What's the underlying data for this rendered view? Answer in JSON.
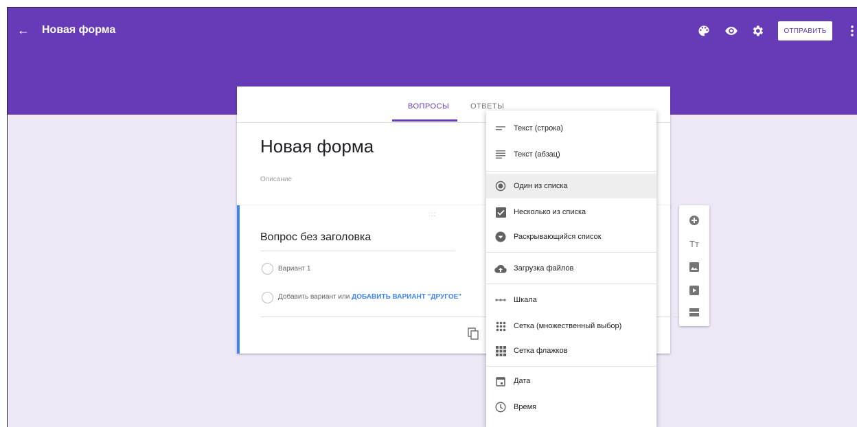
{
  "header": {
    "back_icon": "arrow-left-icon",
    "title": "Новая форма",
    "icons": [
      "palette-icon",
      "eye-icon",
      "gear-icon"
    ],
    "send_label": "ОТПРАВИТЬ",
    "more_icon": "more-vert-icon",
    "color": "#673ab7"
  },
  "tabs": {
    "questions": "ВОПРОСЫ",
    "answers": "ОТВЕТЫ",
    "active": "ВОПРОСЫ"
  },
  "form": {
    "title": "Новая форма",
    "description_placeholder": "Описание"
  },
  "question": {
    "title": "Вопрос без заголовка",
    "option_1": "Вариант 1",
    "add_option": "Добавить вариант",
    "or": "или",
    "add_other": "ДОБАВИТЬ ВАРИАНТ \"ДРУГОЕ\""
  },
  "menu": {
    "items": [
      {
        "label": "Текст (строка)",
        "icon": "short-text-icon"
      },
      {
        "label": "Текст (абзац)",
        "icon": "paragraph-icon"
      },
      {
        "label": "Один из списка",
        "icon": "radio-button-icon"
      },
      {
        "label": "Несколько из списка",
        "icon": "checkbox-icon"
      },
      {
        "label": "Раскрывающийся список",
        "icon": "dropdown-icon"
      },
      {
        "label": "Загрузка файлов",
        "icon": "cloud-upload-icon"
      },
      {
        "label": "Шкала",
        "icon": "linear-scale-icon"
      },
      {
        "label": "Сетка (множественный выбор)",
        "icon": "grid-icon"
      },
      {
        "label": "Сетка флажков",
        "icon": "checkbox-grid-icon"
      },
      {
        "label": "Дата",
        "icon": "calendar-icon"
      },
      {
        "label": "Время",
        "icon": "clock-icon"
      }
    ],
    "selected": "Один из списка"
  },
  "toolbar": {
    "icons": [
      "add-question-icon",
      "title-text-icon",
      "image-icon",
      "video-icon",
      "section-icon"
    ],
    "title_glyph": "Tт"
  }
}
